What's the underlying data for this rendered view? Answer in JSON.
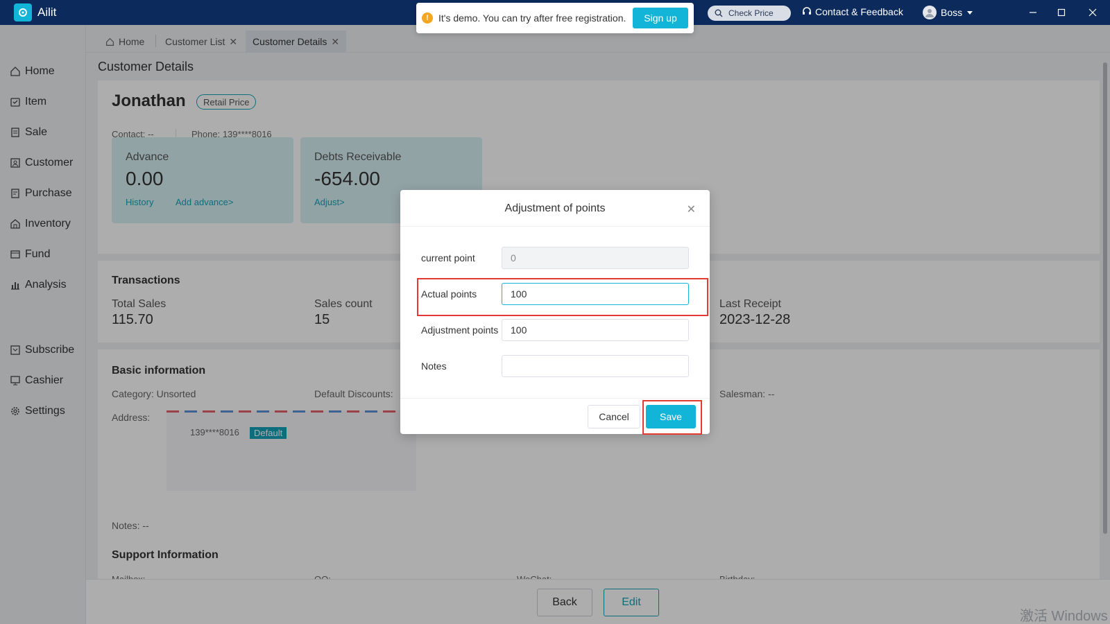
{
  "app": {
    "name": "Ailit"
  },
  "notice": {
    "text": "It's demo. You can try after free registration.",
    "signup_label": "Sign up",
    "icon": "info-icon"
  },
  "topbar": {
    "check_price": "Check Price",
    "contact": "Contact & Feedback",
    "user": "Boss"
  },
  "sidebar": {
    "items": [
      {
        "label": "Home",
        "icon": "home-icon"
      },
      {
        "label": "Item",
        "icon": "item-icon"
      },
      {
        "label": "Sale",
        "icon": "sale-icon"
      },
      {
        "label": "Customer",
        "icon": "customer-icon"
      },
      {
        "label": "Purchase",
        "icon": "purchase-icon"
      },
      {
        "label": "Inventory",
        "icon": "inventory-icon"
      },
      {
        "label": "Fund",
        "icon": "fund-icon"
      },
      {
        "label": "Analysis",
        "icon": "analysis-icon"
      },
      {
        "label": "Subscribe",
        "icon": "subscribe-icon"
      },
      {
        "label": "Cashier",
        "icon": "cashier-icon"
      },
      {
        "label": "Settings",
        "icon": "settings-icon"
      }
    ]
  },
  "tabs": [
    {
      "label": "Home"
    },
    {
      "label": "Customer List"
    },
    {
      "label": "Customer Details",
      "active": true
    }
  ],
  "page": {
    "title": "Customer Details"
  },
  "customer": {
    "name": "Jonathan",
    "price_badge": "Retail Price",
    "contact": "Contact:  --",
    "phone": "Phone:  139****8016"
  },
  "finance": {
    "advance": {
      "label": "Advance",
      "value": "0.00",
      "history": "History",
      "add": "Add advance>"
    },
    "debts": {
      "label": "Debts Receivable",
      "value": "-654.00",
      "adjust": "Adjust>"
    }
  },
  "transactions": {
    "title": "Transactions",
    "total_sales_label": "Total Sales",
    "total_sales": "115.70",
    "sales_count_label": "Sales count",
    "sales_count": "15",
    "last_receipt_label": "Last Receipt",
    "last_receipt": "2023-12-28"
  },
  "basic": {
    "title": "Basic information",
    "category": "Category:  Unsorted",
    "default_discounts": "Default Discounts:",
    "salesman": "Salesman:  --",
    "address_label": "Address:",
    "address_phone": "139****8016",
    "default_tag": "Default",
    "notes": "Notes:  --"
  },
  "support": {
    "title": "Support Information",
    "mailbox": "Mailbox:",
    "qq": "QQ:",
    "wechat": "WeChat:",
    "birthday": "Birthday:"
  },
  "footer": {
    "back": "Back",
    "edit": "Edit"
  },
  "watermark": "激活 Windows",
  "dialog": {
    "title": "Adjustment of points",
    "current_point_label": "current point",
    "current_point_value": "0",
    "actual_points_label": "Actual points",
    "actual_points_value": "100",
    "adjustment_points_label": "Adjustment points",
    "adjustment_points_value": "100",
    "notes_label": "Notes",
    "notes_value": "",
    "cancel": "Cancel",
    "save": "Save"
  },
  "colors": {
    "accent": "#12b5d8",
    "titlebar": "#0c2a5c",
    "highlight": "#e53935"
  }
}
